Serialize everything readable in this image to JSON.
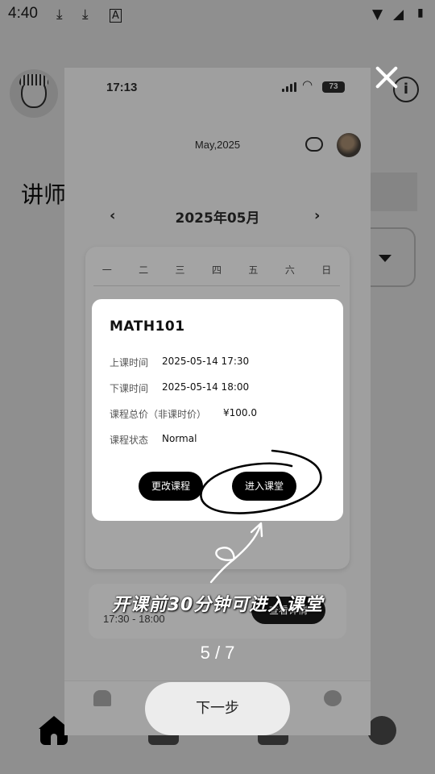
{
  "status_bar": {
    "time": "4:40"
  },
  "background_app": {
    "title_partial": "讲师"
  },
  "guide": {
    "step_text": "5 / 7",
    "hint": "开课前30分钟可进入课堂",
    "next_label": "下一步"
  },
  "phone": {
    "time": "17:13",
    "battery": "73",
    "month_header": "May,2025",
    "calendar_title": "2025年05月",
    "prev_glyph": "‹",
    "next_glyph": "›",
    "weekdays": [
      "一",
      "二",
      "三",
      "四",
      "五",
      "六",
      "日"
    ],
    "lower_time": "17:30 - 18:00",
    "lower_button": "查看详情"
  },
  "popup": {
    "course_code": "MATH101",
    "rows": [
      {
        "label": "上课时间",
        "value": "2025-05-14 17:30"
      },
      {
        "label": "下课时间",
        "value": "2025-05-14 18:00"
      },
      {
        "label": "课程总价（非课时价）",
        "value": "¥100.0"
      },
      {
        "label": "课程状态",
        "value": "Normal"
      }
    ],
    "change_button": "更改课程",
    "enter_button": "进入课堂"
  },
  "colors": {
    "dim_overlay": "rgba(0,0,0,0.44)",
    "accent_button": "#000000",
    "annotation": "#ffffff"
  }
}
